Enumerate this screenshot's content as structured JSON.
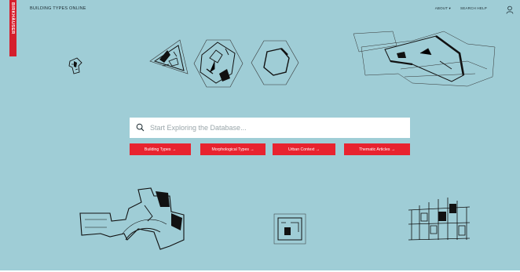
{
  "brand": {
    "label": "BIRKHÄUSER",
    "color": "#d51f2d"
  },
  "header": {
    "site_title": "BUILDING TYPES ONLINE",
    "nav": {
      "about": "ABOUT ▾",
      "search_help": "SEARCH HELP"
    },
    "user_icon": "user-icon"
  },
  "search": {
    "placeholder": "Start Exploring the Database...",
    "value": "",
    "icon": "search-icon"
  },
  "categories": [
    {
      "label": "Building Types →"
    },
    {
      "label": "Morphological Types →"
    },
    {
      "label": "Urban Context →"
    },
    {
      "label": "Thematic Articles →"
    }
  ],
  "colors": {
    "background": "#9fcdd6",
    "accent": "#e8232f",
    "ink": "#1b2a30"
  }
}
